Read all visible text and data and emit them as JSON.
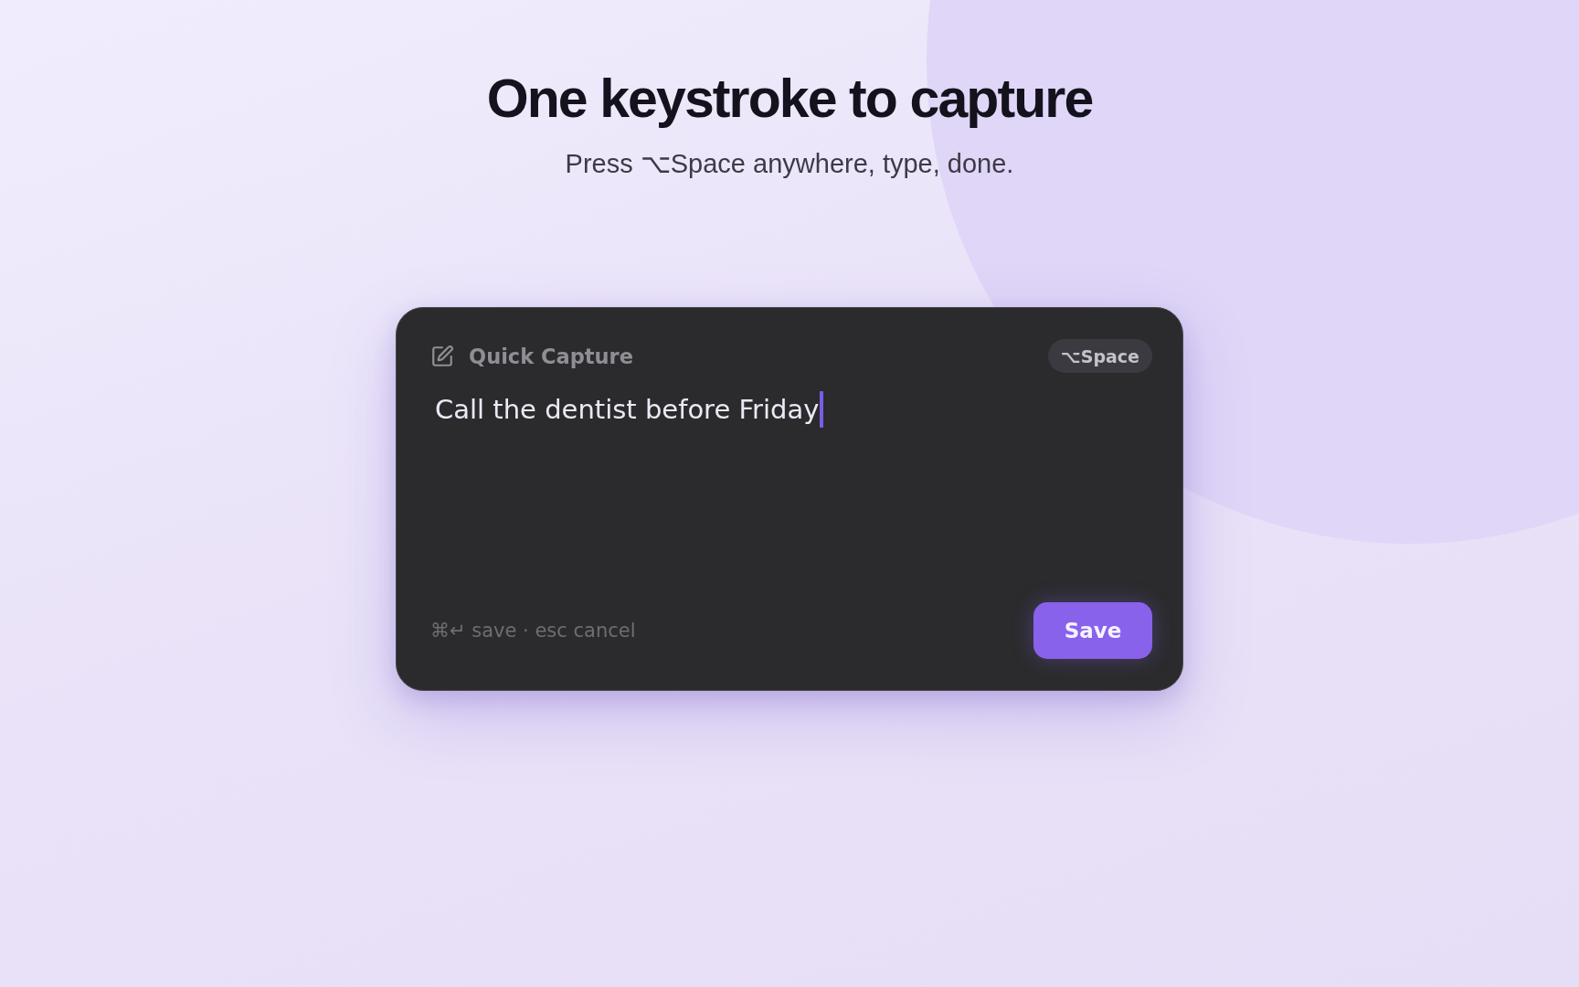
{
  "heading": {
    "title": "One keystroke to capture",
    "subtitle": "Press ⌥Space anywhere, type, done."
  },
  "capture_window": {
    "title": "Quick Capture",
    "shortcut": "⌥Space",
    "note": {
      "value": "Call the dentist before Friday",
      "focused": true
    },
    "hint": "⌘↵ save · esc cancel",
    "button": "Save"
  }
}
